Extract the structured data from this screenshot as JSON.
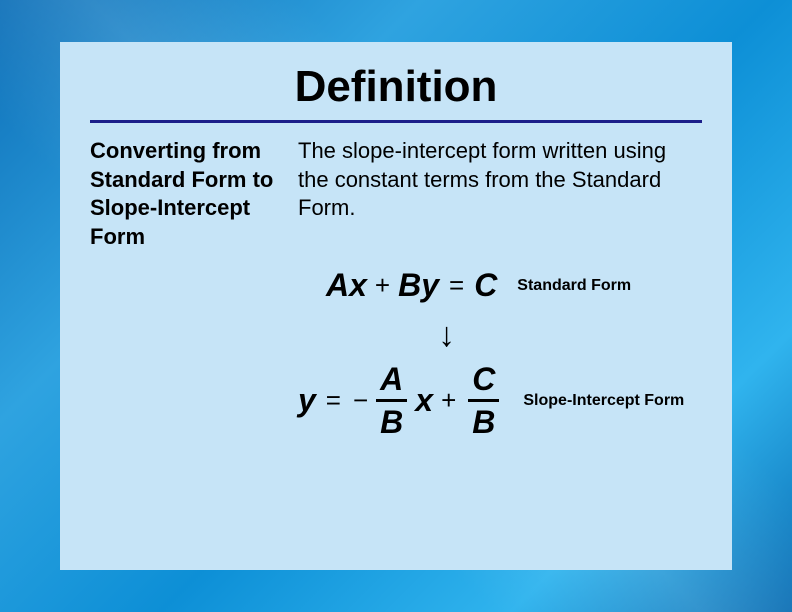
{
  "title": "Definition",
  "leftHeading": "Converting from Standard Form to Slope-Intercept Form",
  "description": "The slope-intercept form written using the constant terms from the Standard Form.",
  "equations": {
    "standard": {
      "A": "A",
      "x": "x",
      "plus": "+",
      "B": "B",
      "y": "y",
      "eq": "=",
      "C": "C",
      "label": "Standard Form"
    },
    "arrow": "↓",
    "slopeIntercept": {
      "y": "y",
      "eq": "=",
      "neg": "−",
      "fracA": "A",
      "fracB": "B",
      "x": "x",
      "plus": "+",
      "fracC": "C",
      "fracB2": "B",
      "label": "Slope-Intercept Form"
    }
  }
}
